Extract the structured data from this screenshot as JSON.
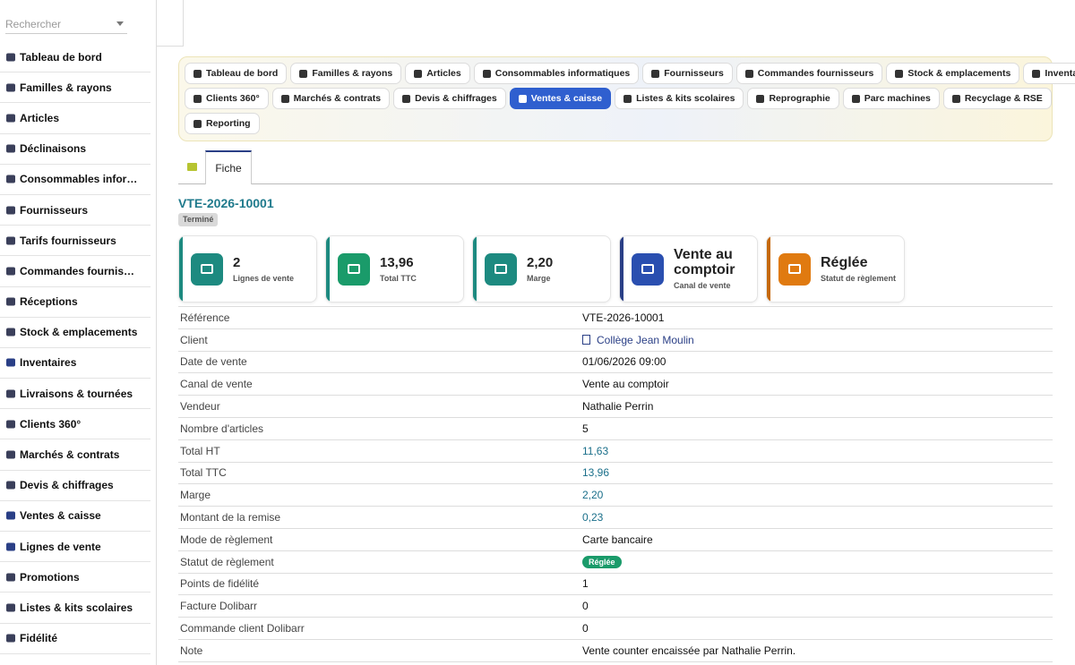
{
  "search": {
    "placeholder": "Rechercher"
  },
  "sidebar": {
    "items": [
      {
        "label": "Tableau de bord",
        "icon": "dashboard-icon",
        "color": "#3a3f5a"
      },
      {
        "label": "Familles & rayons",
        "icon": "sitemap-icon",
        "color": "#3a3f5a"
      },
      {
        "label": "Articles",
        "icon": "box-icon",
        "color": "#3a3f5a"
      },
      {
        "label": "Déclinaisons",
        "icon": "layers-icon",
        "color": "#3a3f5a"
      },
      {
        "label": "Consommables infor…",
        "icon": "printer-icon",
        "color": "#3a3f5a"
      },
      {
        "label": "Fournisseurs",
        "icon": "truck-loading-icon",
        "color": "#3a3f5a"
      },
      {
        "label": "Tarifs fournisseurs",
        "icon": "tags-icon",
        "color": "#3a3f5a"
      },
      {
        "label": "Commandes fournis…",
        "icon": "cart-icon",
        "color": "#3a3f5a"
      },
      {
        "label": "Réceptions",
        "icon": "dolly-icon",
        "color": "#3a3f5a"
      },
      {
        "label": "Stock & emplacements",
        "icon": "warehouse-icon",
        "color": "#3a3f5a"
      },
      {
        "label": "Inventaires",
        "icon": "clipboard-check-icon",
        "color": "#2a3f86"
      },
      {
        "label": "Livraisons & tournées",
        "icon": "delivery-truck-icon",
        "color": "#3a3f5a"
      },
      {
        "label": "Clients 360°",
        "icon": "users-icon",
        "color": "#3a3f5a"
      },
      {
        "label": "Marchés & contrats",
        "icon": "contract-icon",
        "color": "#3a3f5a"
      },
      {
        "label": "Devis & chiffrages",
        "icon": "quote-icon",
        "color": "#3a3f5a"
      },
      {
        "label": "Ventes & caisse",
        "icon": "cash-register-icon",
        "color": "#2a3f86"
      },
      {
        "label": "Lignes de vente",
        "icon": "list-icon",
        "color": "#2a3f86"
      },
      {
        "label": "Promotions",
        "icon": "percent-icon",
        "color": "#3a3f5a"
      },
      {
        "label": "Listes & kits scolaires",
        "icon": "graduation-cap-icon",
        "color": "#3a3f5a"
      },
      {
        "label": "Fidélité",
        "icon": "loyalty-icon",
        "color": "#3a3f5a"
      }
    ]
  },
  "nav": {
    "rows": [
      [
        {
          "label": "Tableau de bord",
          "icon": "dashboard-icon",
          "active": false
        },
        {
          "label": "Familles & rayons",
          "icon": "sitemap-icon",
          "active": false
        },
        {
          "label": "Articles",
          "icon": "box-icon",
          "active": false
        },
        {
          "label": "Consommables informatiques",
          "icon": "printer-icon",
          "active": false
        },
        {
          "label": "Fournisseurs",
          "icon": "truck-loading-icon",
          "active": false
        },
        {
          "label": "Commandes fournisseurs",
          "icon": "cart-icon",
          "active": false
        },
        {
          "label": "Stock & emplacements",
          "icon": "warehouse-icon",
          "active": false
        },
        {
          "label": "Inventaires",
          "icon": "clipboard-check-icon",
          "active": false
        }
      ],
      [
        {
          "label": "Clients 360°",
          "icon": "users-icon",
          "active": false
        },
        {
          "label": "Marchés & contrats",
          "icon": "contract-icon",
          "active": false
        },
        {
          "label": "Devis & chiffrages",
          "icon": "quote-icon",
          "active": false
        },
        {
          "label": "Ventes & caisse",
          "icon": "cash-register-icon",
          "active": true
        },
        {
          "label": "Listes & kits scolaires",
          "icon": "graduation-cap-icon",
          "active": false
        },
        {
          "label": "Reprographie",
          "icon": "copy-icon",
          "active": false
        },
        {
          "label": "Parc machines",
          "icon": "cogs-icon",
          "active": false
        },
        {
          "label": "Recyclage & RSE",
          "icon": "recycle-icon",
          "active": false
        }
      ],
      [
        {
          "label": "Reporting",
          "icon": "chart-pie-icon",
          "active": false
        }
      ]
    ]
  },
  "tabs": {
    "fiche_label": "Fiche"
  },
  "record": {
    "ref": "VTE-2026-10001",
    "status": "Terminé"
  },
  "kpis": [
    {
      "value": "2",
      "label": "Lignes de vente",
      "icon": "list-icon",
      "color": "#1d8a80",
      "bar": "#1d8a80"
    },
    {
      "value": "13,96",
      "label": "Total TTC",
      "icon": "coins-icon",
      "color": "#1a9b6a",
      "bar": "#1d8a80"
    },
    {
      "value": "2,20",
      "label": "Marge",
      "icon": "chart-line-icon",
      "color": "#1d8a80",
      "bar": "#1d8a80"
    },
    {
      "value": "Vente au comptoir",
      "label": "Canal de vente",
      "icon": "cash-register-icon",
      "color": "#2a4fb0",
      "bar": "#2a3f86"
    },
    {
      "value": "Réglée",
      "label": "Statut de règlement",
      "icon": "credit-card-icon",
      "color": "#e07a10",
      "bar": "#c5690c"
    }
  ],
  "details": [
    {
      "label": "Référence",
      "value": "VTE-2026-10001",
      "kind": "text"
    },
    {
      "label": "Client",
      "value": "Collège Jean Moulin",
      "kind": "link"
    },
    {
      "label": "Date de vente",
      "value": "01/06/2026 09:00",
      "kind": "text"
    },
    {
      "label": "Canal de vente",
      "value": "Vente au comptoir",
      "kind": "text"
    },
    {
      "label": "Vendeur",
      "value": "Nathalie Perrin",
      "kind": "text"
    },
    {
      "label": "Nombre d'articles",
      "value": "5",
      "kind": "text"
    },
    {
      "label": "Total HT",
      "value": "11,63",
      "kind": "num"
    },
    {
      "label": "Total TTC",
      "value": "13,96",
      "kind": "num"
    },
    {
      "label": "Marge",
      "value": "2,20",
      "kind": "num"
    },
    {
      "label": "Montant de la remise",
      "value": "0,23",
      "kind": "num"
    },
    {
      "label": "Mode de règlement",
      "value": "Carte bancaire",
      "kind": "text"
    },
    {
      "label": "Statut de règlement",
      "value": "Réglée",
      "kind": "pill"
    },
    {
      "label": "Points de fidélité",
      "value": "1",
      "kind": "text"
    },
    {
      "label": "Facture Dolibarr",
      "value": "0",
      "kind": "text"
    },
    {
      "label": "Commande client Dolibarr",
      "value": "0",
      "kind": "text"
    },
    {
      "label": "Note",
      "value": "Vente counter encaissée par Nathalie Perrin.",
      "kind": "text"
    }
  ]
}
